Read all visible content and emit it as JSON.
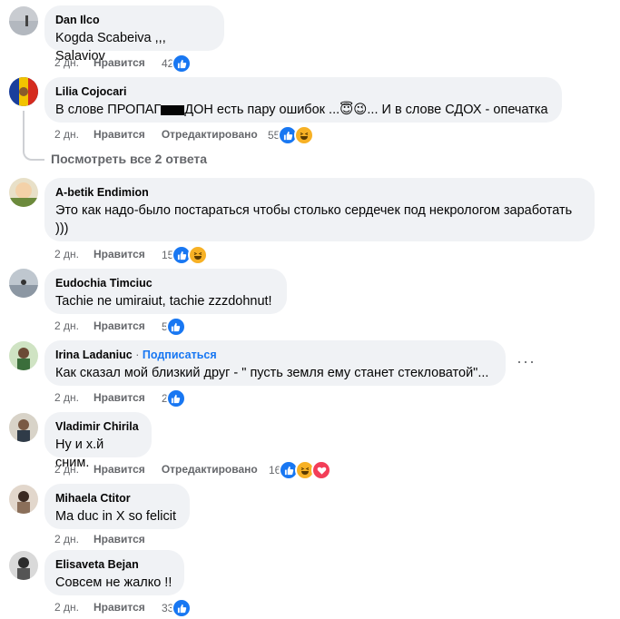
{
  "comments": [
    {
      "name": "Dan Ilco",
      "text": "Kogda Scabeiva ,,, Salaviov",
      "age": "2 дн.",
      "like": "Нравится",
      "edited": "",
      "count": "42",
      "reactions": [
        "like-icon"
      ]
    },
    {
      "name": "Lilia Cojocari",
      "text_parts": [
        "В слове ПРОПАГ",
        "ДОН есть пару ошибок ...",
        "😇",
        "😉",
        "... И в слове СДОХ - опечатка"
      ],
      "age": "2 дн.",
      "like": "Нравится",
      "edited": "Отредактировано",
      "count": "55",
      "reactions": [
        "like-icon",
        "haha-icon"
      ]
    },
    {
      "name": "A-betik Endimion",
      "text": "Это как надо-было постараться чтобы столько сердечек под некрологом заработать )))",
      "age": "2 дн.",
      "like": "Нравится",
      "edited": "",
      "count": "15",
      "reactions": [
        "like-icon",
        "haha-icon"
      ]
    },
    {
      "name": "Eudochia Timciuc",
      "text": "Tachie ne umiraiut, tachie zzzdohnut!",
      "age": "2 дн.",
      "like": "Нравится",
      "edited": "",
      "count": "5",
      "reactions": [
        "like-icon"
      ]
    },
    {
      "name": "Irina Ladaniuc",
      "follow": "Подписаться",
      "dot": "·",
      "text": "Как сказал мой близкий друг - \" пусть земля ему станет стекловатой\"...",
      "age": "2 дн.",
      "like": "Нравится",
      "edited": "",
      "count": "2",
      "reactions": [
        "like-icon"
      ]
    },
    {
      "name": "Vladimir Chirila",
      "text": "Ну и х.й сним.",
      "age": "2 дн.",
      "like": "Нравится",
      "edited": "Отредактировано",
      "count": "16",
      "reactions": [
        "like-icon",
        "haha-icon",
        "love-icon"
      ]
    },
    {
      "name": "Mihaela Ctitor",
      "text": "Ma duc in X so felicit",
      "age": "2 дн.",
      "like": "Нравится",
      "edited": "",
      "count": "",
      "reactions": []
    },
    {
      "name": "Elisaveta Bejan",
      "text": "Совсем не жалко !!",
      "age": "2 дн.",
      "like": "Нравится",
      "edited": "",
      "count": "33",
      "reactions": [
        "like-icon"
      ]
    }
  ],
  "view_replies": "Посмотреть все 2 ответа",
  "more_options": "···",
  "colors": {
    "bubble": "#f0f2f5",
    "meta": "#65676b",
    "like": "#1877f2",
    "haha": "#f7b125",
    "love": "#f33e58"
  }
}
